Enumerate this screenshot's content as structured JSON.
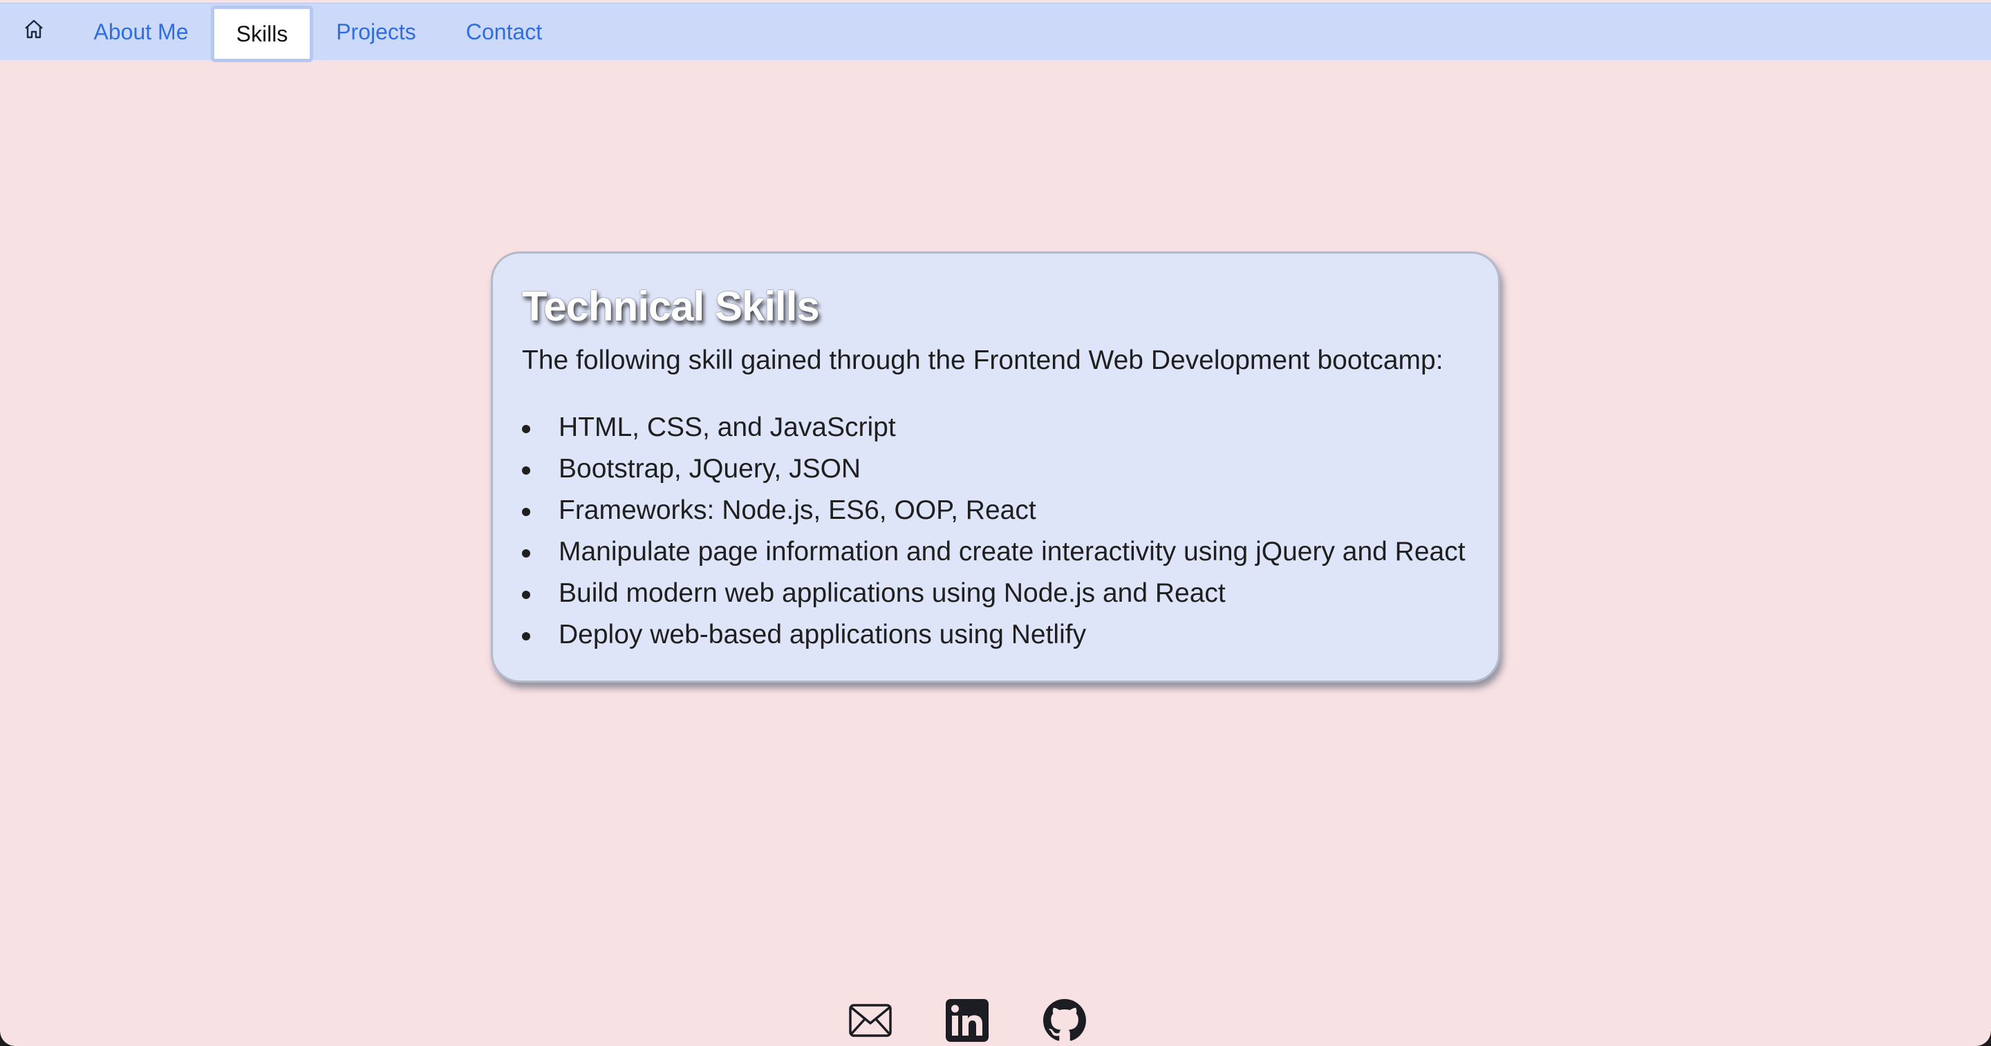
{
  "nav": {
    "home_icon": "house-icon",
    "items": [
      {
        "label": "About Me"
      },
      {
        "label": "Skills",
        "active": true
      },
      {
        "label": "Projects"
      },
      {
        "label": "Contact"
      }
    ]
  },
  "card": {
    "title": "Technical Skills",
    "intro": "The following skill gained through the Frontend Web Development bootcamp:",
    "skills": [
      "HTML, CSS, and JavaScript",
      "Bootstrap, JQuery, JSON",
      "Frameworks: Node.js, ES6, OOP, React",
      "Manipulate page information and create interactivity using jQuery and React",
      "Build modern web applications using Node.js and React",
      "Deploy web-based applications using Netlify"
    ]
  },
  "footer": {
    "icons": [
      "envelope-icon",
      "linkedin-icon",
      "github-icon"
    ]
  },
  "colors": {
    "page_background": "#f8e1e3",
    "navbar_background": "#ccd9f8",
    "nav_link": "#2f6ee0",
    "card_background": "#dfe5f8"
  }
}
